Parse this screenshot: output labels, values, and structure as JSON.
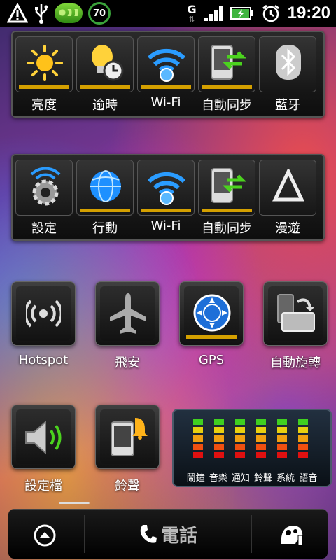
{
  "status_bar": {
    "time": "19:20",
    "battery_percent_badge": "70",
    "network_type": "G",
    "icons": [
      "warning-icon",
      "usb-icon",
      "pea-icon",
      "battery-ring-icon",
      "network-g-icon",
      "signal-icon",
      "battery-icon",
      "alarm-icon"
    ]
  },
  "panel1": {
    "tiles": [
      {
        "label": "亮度",
        "icon": "brightness-sun-icon",
        "on": true
      },
      {
        "label": "逾時",
        "icon": "timeout-bulb-icon",
        "on": true
      },
      {
        "label": "Wi-Fi",
        "icon": "wifi-icon",
        "on": true
      },
      {
        "label": "自動同步",
        "icon": "sync-icon",
        "on": true
      },
      {
        "label": "藍牙",
        "icon": "bluetooth-icon",
        "on": false
      }
    ]
  },
  "panel2": {
    "tiles": [
      {
        "label": "設定",
        "icon": "settings-gear-icon",
        "on": false
      },
      {
        "label": "行動",
        "icon": "mobile-data-globe-icon",
        "on": true
      },
      {
        "label": "Wi-Fi",
        "icon": "wifi-icon",
        "on": true
      },
      {
        "label": "自動同步",
        "icon": "sync-icon",
        "on": true
      },
      {
        "label": "漫遊",
        "icon": "roaming-triangle-icon",
        "on": false
      }
    ]
  },
  "toggles_row1": [
    {
      "label": "Hotspot",
      "icon": "hotspot-icon",
      "on": false
    },
    {
      "label": "飛安",
      "icon": "airplane-icon",
      "on": false
    },
    {
      "label": "GPS",
      "icon": "gps-icon",
      "on": true
    },
    {
      "label": "自動旋轉",
      "icon": "auto-rotate-icon",
      "on": false
    }
  ],
  "toggles_row2": [
    {
      "label": "設定檔",
      "icon": "speaker-profile-icon"
    },
    {
      "label": "鈴聲",
      "icon": "ringtone-bell-icon"
    }
  ],
  "volume_widget": {
    "labels": "鬧鐘 音樂 通知 鈴聲 系統 語音",
    "levels": [
      5,
      5,
      5,
      5,
      5,
      5
    ],
    "colors": [
      "#e01010",
      "#f05010",
      "#f0a010",
      "#e8d010",
      "#40d020"
    ]
  },
  "dock": {
    "phone_label": "電話",
    "left_icon": "app-drawer-up-icon",
    "right_icon": "personalize-icon"
  }
}
